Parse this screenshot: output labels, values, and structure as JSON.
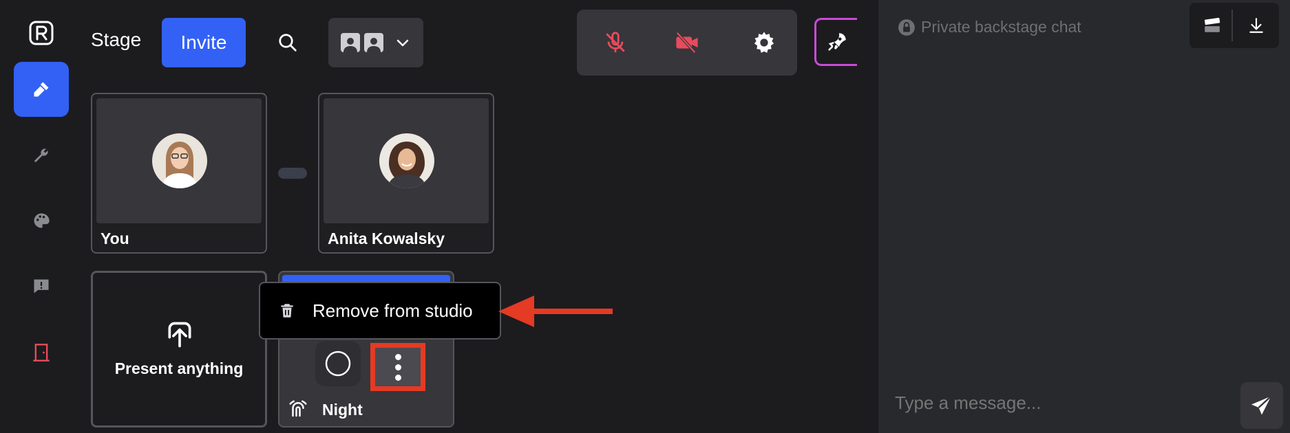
{
  "header": {
    "stage_label": "Stage",
    "invite_label": "Invite"
  },
  "rail": {
    "items": [
      {
        "name": "microphone",
        "active": true
      },
      {
        "name": "wrench",
        "active": false
      },
      {
        "name": "palette",
        "active": false
      },
      {
        "name": "feedback",
        "active": false
      },
      {
        "name": "exit-door",
        "active": false
      }
    ]
  },
  "participants": [
    {
      "name": "You"
    },
    {
      "name": "Anita Kowalsky"
    }
  ],
  "present_tile": {
    "label": "Present anything"
  },
  "scene_tile": {
    "name": "Night"
  },
  "context_menu": {
    "remove_label": "Remove from studio"
  },
  "chat": {
    "title": "Private backstage chat",
    "input_placeholder": "Type a message..."
  },
  "colors": {
    "accent": "#3361f5",
    "danger": "#e53a24",
    "muted_icon": "#e94b5b",
    "background": "#1c1c1f",
    "panel": "#28292d"
  }
}
